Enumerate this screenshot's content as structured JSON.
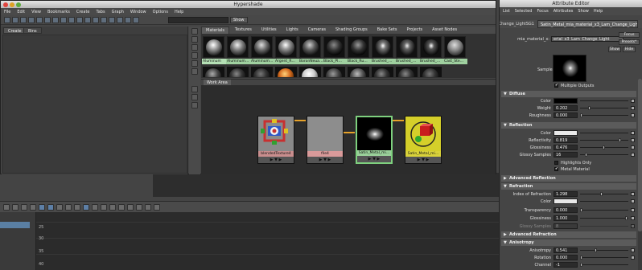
{
  "hypershade": {
    "title": "Hypershade",
    "menu": [
      "File",
      "Edit",
      "View",
      "Bookmarks",
      "Create",
      "Tabs",
      "Graph",
      "Window",
      "Options",
      "Help"
    ],
    "show_button": "Show",
    "left_tabs": [
      "Create",
      "Bins"
    ],
    "material_tabs": [
      "Materials",
      "Textures",
      "Utilities",
      "Lights",
      "Cameras",
      "Shading Groups",
      "Bake Sets",
      "Projects",
      "Asset Nodes"
    ],
    "swatches": [
      "Aluminum",
      "Aluminum…",
      "Aluminum…",
      "Argent_R…",
      "BoronNeua…",
      "Black_Pl…",
      "Black_Ru…",
      "Brushed_…",
      "Brushed_…",
      "Brushed_…",
      "Cast_Ste…"
    ],
    "work_area_tab": "Work Area",
    "nodes": [
      {
        "label": "blendedTexture4",
        "color": "#c98e8e"
      },
      {
        "label": "file4",
        "color": "#d99a9a"
      },
      {
        "label": "Satin_Metal_mi…",
        "color": "#9ad09a"
      },
      {
        "label": "Satin_Metal_mi…",
        "color": "#d9d23a"
      }
    ],
    "port_glyphs": "▶  ▼  ▶"
  },
  "background": {
    "timeline_numbers": [
      "25",
      "30",
      "35",
      "40"
    ]
  },
  "attribute_editor": {
    "title": "Attribute Editor",
    "menu": [
      "List",
      "Selected",
      "Focus",
      "Attributes",
      "Show",
      "Help"
    ],
    "tabs": [
      "Change_LightSG1",
      "Satin_Metal_mia_material_x3_Lam_Change_Light"
    ],
    "node_label": "mia_material_x:",
    "node_value": "erial_x3_Lam_Change_Light",
    "focus_button": "Focus",
    "presets_button": "Presets*",
    "show_button": "Show",
    "hide_button": "Hide",
    "sample_label": "Sample",
    "multiple_outputs": "Multiple Outputs",
    "sections": {
      "diffuse": "Diffuse",
      "reflection": "Reflection",
      "advanced_reflection": "Advanced Reflection",
      "refraction": "Refraction",
      "advanced_refraction": "Advanced Refraction",
      "anisotropy": "Anisotropy"
    },
    "diffuse": {
      "color_label": "Color",
      "weight_label": "Weight",
      "weight_value": "0.202",
      "roughness_label": "Roughness",
      "roughness_value": "0.000"
    },
    "reflection": {
      "color_label": "Color",
      "reflectivity_label": "Reflectivity",
      "reflectivity_value": "0.819",
      "glossiness_label": "Glossiness",
      "glossiness_value": "0.476",
      "samples_label": "Glossy Samples",
      "samples_value": "16",
      "highlights_only": "Highlights Only",
      "metal_material": "Metal Material"
    },
    "refraction": {
      "ior_label": "Index of Refraction",
      "ior_value": "1.298",
      "color_label": "Color",
      "transparency_label": "Transparency",
      "transparency_value": "0.000",
      "glossiness_label": "Glossiness",
      "glossiness_value": "1.000",
      "samples_label": "Glossy Samples",
      "samples_value": "8"
    },
    "anisotropy": {
      "anisotropy_label": "Anisotropy",
      "anisotropy_value": "0.541",
      "rotation_label": "Rotation",
      "rotation_value": "0.000",
      "channel_label": "Channel",
      "channel_value": "-1"
    },
    "check_glyph": "✔",
    "section_arrow_open": "▼",
    "section_arrow_closed": "▶"
  }
}
